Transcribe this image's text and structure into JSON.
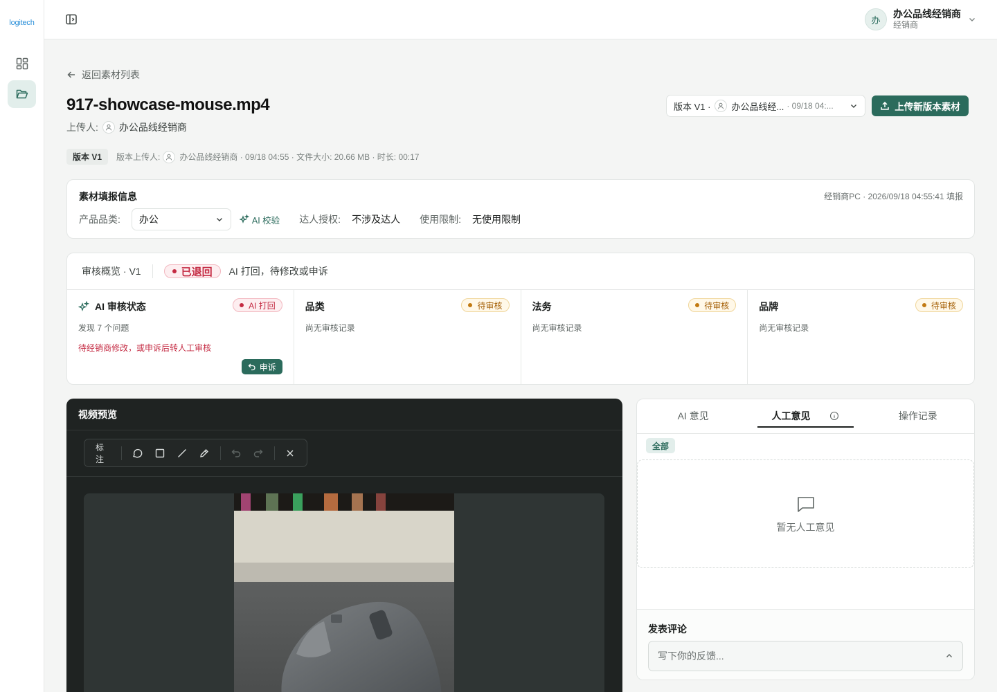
{
  "brand": {
    "logo_text": "logitech"
  },
  "user": {
    "avatar_char": "办",
    "name": "办公品线经销商",
    "role": "经销商"
  },
  "nav": {
    "back_label": "返回素材列表"
  },
  "file": {
    "title": "917-showcase-mouse.mp4",
    "uploader_label": "上传人:",
    "uploader_name": "办公品线经销商"
  },
  "version_select": {
    "prefix": "版本 V1 ·",
    "name": "办公品线经...",
    "date": "· 09/18 04:..."
  },
  "upload_button": "上传新版本素材",
  "meta": {
    "version_badge": "版本 V1",
    "uploader_label": "版本上传人:",
    "details": "办公品线经销商 · 09/18 04:55 · 文件大小: 20.66 MB · 时长: 00:17"
  },
  "info": {
    "title": "素材填报信息",
    "filled": "经销商PC · 2026/09/18 04:55:41 填报",
    "category_label": "产品品类:",
    "category_value": "办公",
    "ai_check": "AI 校验",
    "talent_label": "达人授权:",
    "talent_value": "不涉及达人",
    "usage_label": "使用限制:",
    "usage_value": "无使用限制"
  },
  "review": {
    "title": "审核概览 · V1",
    "status": "已退回",
    "message": "AI 打回，待修改或申诉",
    "columns": [
      {
        "title": "AI 审核状态",
        "status": "AI 打回",
        "sub": "发现 7 个问题",
        "warn": "待经销商修改，或申诉后转人工审核",
        "action": "申诉"
      },
      {
        "title": "品类",
        "status": "待审核",
        "sub": "尚无审核记录"
      },
      {
        "title": "法务",
        "status": "待审核",
        "sub": "尚无审核记录"
      },
      {
        "title": "品牌",
        "status": "待审核",
        "sub": "尚无审核记录"
      }
    ]
  },
  "video": {
    "title": "视频预览",
    "toolbar_label": "标注"
  },
  "comments": {
    "tabs": [
      "AI 意见",
      "人工意见",
      "操作记录"
    ],
    "active_tab": "人工意见",
    "filter": "全部",
    "empty": "暂无人工意见",
    "post_label": "发表评论",
    "input_placeholder": "写下你的反馈..."
  },
  "colors": {
    "accent": "#2b6b5c",
    "danger": "#c42a42",
    "warning": "#a6620a"
  }
}
